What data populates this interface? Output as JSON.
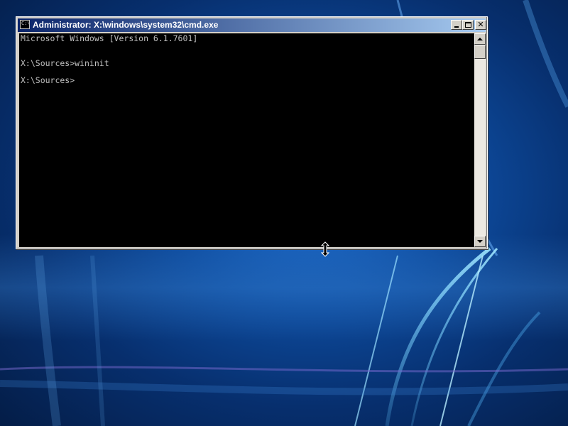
{
  "window": {
    "title": "Administrator: X:\\windows\\system32\\cmd.exe",
    "icon": "cmd-icon",
    "icon_glyph": "C:\\",
    "buttons": {
      "minimize": "minimize-icon",
      "maximize": "maximize-icon",
      "close": "close-icon",
      "close_glyph": "✕"
    }
  },
  "console": {
    "lines": [
      "Microsoft Windows [Version 6.1.7601]",
      "X:\\Sources>wininit",
      "X:\\Sources>"
    ],
    "background": "#000000",
    "text_color": "#c0c0c0"
  },
  "scrollbar": {
    "up_icon": "up-arrow-icon",
    "down_icon": "down-arrow-icon"
  },
  "cursor": {
    "icon": "vertical-resize-cursor-icon"
  },
  "colors": {
    "titlebar_start": "#0a246a",
    "titlebar_end": "#a6caf0",
    "window_face": "#d4d0c8",
    "desktop": "#0d4a9c"
  }
}
